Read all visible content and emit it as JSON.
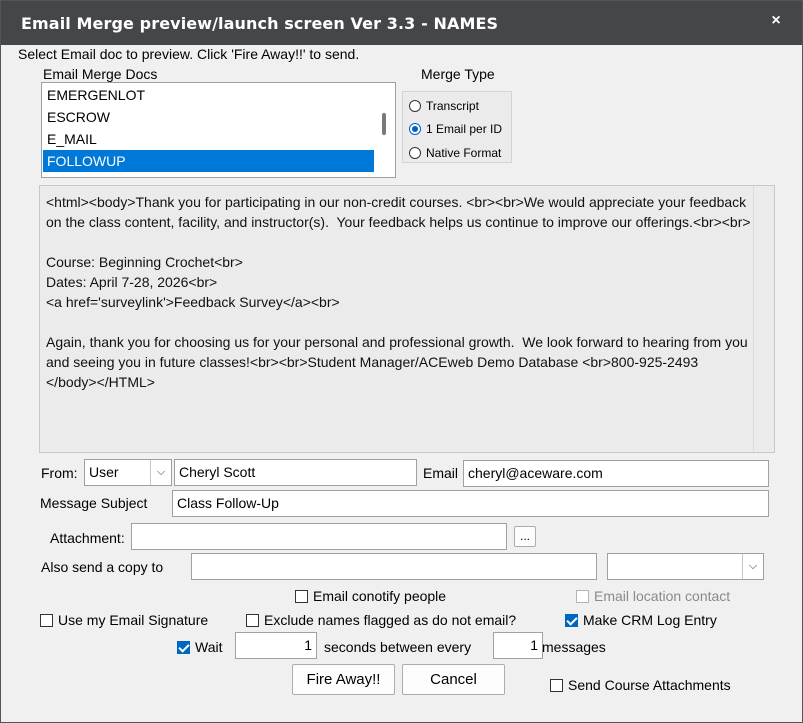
{
  "window": {
    "title": "Email Merge preview/launch screen Ver 3.3 - NAMES",
    "close_glyph": "×"
  },
  "instructions": "Select  Email doc to preview.   Click 'Fire Away!!' to send.",
  "docs": {
    "label": "Email Merge Docs",
    "items": [
      "EMERGENLOT",
      "ESCROW",
      "E_MAIL",
      "FOLLOWUP"
    ],
    "selected": "FOLLOWUP"
  },
  "merge_type": {
    "label": "Merge Type",
    "options": [
      "Transcript",
      "1 Email per ID",
      "Native Format"
    ],
    "selected": "1 Email per ID"
  },
  "body_preview": "<html><body>Thank you for participating in our non-credit courses. <br><br>We would appreciate your feedback on the class content, facility, and instructor(s).  Your feedback helps us continue to improve our offerings.<br><br>\n\nCourse: Beginning Crochet<br>\nDates: April 7-28, 2026<br>\n<a href='surveylink'>Feedback Survey</a><br>\n\nAgain, thank you for choosing us for your personal and professional growth.  We look forward to hearing from you and seeing you in future classes!<br><br>Student Manager/ACEweb Demo Database <br>800-925-2493        </body></HTML>",
  "from": {
    "label": "From:",
    "type_value": "User",
    "name_value": "Cheryl Scott",
    "email_label": "Email",
    "email_value": "cheryl@aceware.com"
  },
  "subject": {
    "label": "Message Subject",
    "value": "Class Follow-Up"
  },
  "attachment": {
    "label": "Attachment:",
    "value": "",
    "browse_label": "..."
  },
  "copy_to": {
    "label": "Also send a copy to",
    "value": "",
    "select_value": ""
  },
  "options": {
    "conotify": {
      "label": "Email conotify people",
      "checked": false
    },
    "location_contact": {
      "label": "Email location contact",
      "checked": false,
      "enabled": false
    },
    "signature": {
      "label": "Use my Email Signature",
      "checked": false
    },
    "exclude_flagged": {
      "label": "Exclude names flagged as do not email?",
      "checked": false
    },
    "crm_log": {
      "label": "Make CRM Log Entry",
      "checked": true
    },
    "wait": {
      "label": "Wait",
      "checked": true
    },
    "course_attachments": {
      "label": "Send Course Attachments",
      "checked": false
    }
  },
  "throttle": {
    "seconds_value": "1",
    "seconds_label": "seconds between every",
    "messages_value": "1",
    "messages_label": "messages"
  },
  "actions": {
    "fire_label": "Fire Away!!",
    "cancel_label": "Cancel"
  },
  "colors": {
    "titlebar": "#444649",
    "selection": "#0078d7",
    "accent": "#0067c0"
  }
}
